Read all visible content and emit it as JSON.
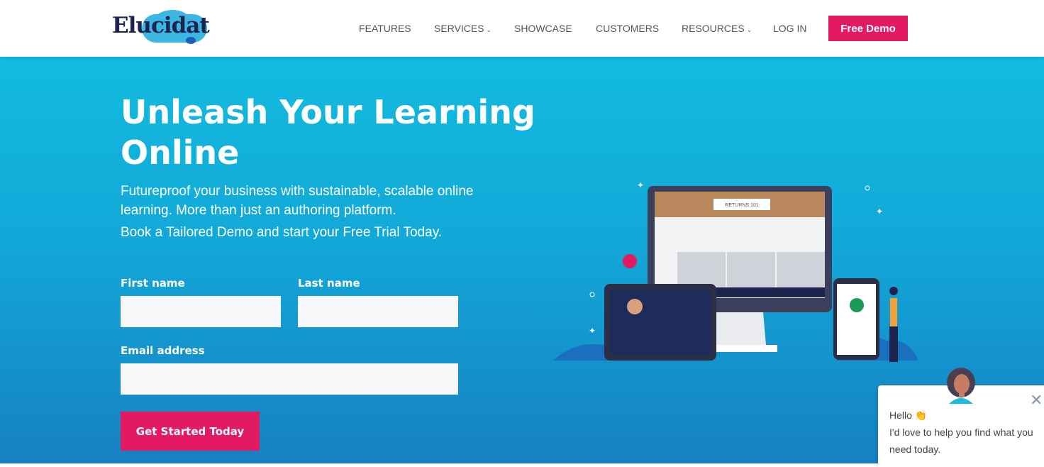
{
  "header": {
    "logo": "Elucidat",
    "nav": [
      {
        "label": "FEATURES",
        "dropdown": false
      },
      {
        "label": "SERVICES",
        "dropdown": true
      },
      {
        "label": "SHOWCASE",
        "dropdown": false
      },
      {
        "label": "CUSTOMERS",
        "dropdown": false
      },
      {
        "label": "RESOURCES",
        "dropdown": true
      },
      {
        "label": "LOG IN",
        "dropdown": false
      }
    ],
    "demo_label": "Free Demo"
  },
  "hero": {
    "title": "Unleash Your Learning Online",
    "subtitle": "Futureproof your business with sustainable, scalable online learning. More than just an authoring platform.",
    "subtitle2": "Book a Tailored Demo and start your Free Trial Today.",
    "illustration_title": "RETURNS 101"
  },
  "form": {
    "first_name_label": "First name",
    "first_name_value": "",
    "last_name_label": "Last name",
    "last_name_value": "",
    "email_label": "Email address",
    "email_value": "",
    "submit_label": "Get Started Today"
  },
  "chat": {
    "greeting": "Hello 👏",
    "message": "I'd love to help you find what you need today."
  },
  "colors": {
    "brand": "#e21a62",
    "hero_top": "#13bbdf",
    "hero_bottom": "#1680c2",
    "logo_navy": "#1c2550"
  }
}
